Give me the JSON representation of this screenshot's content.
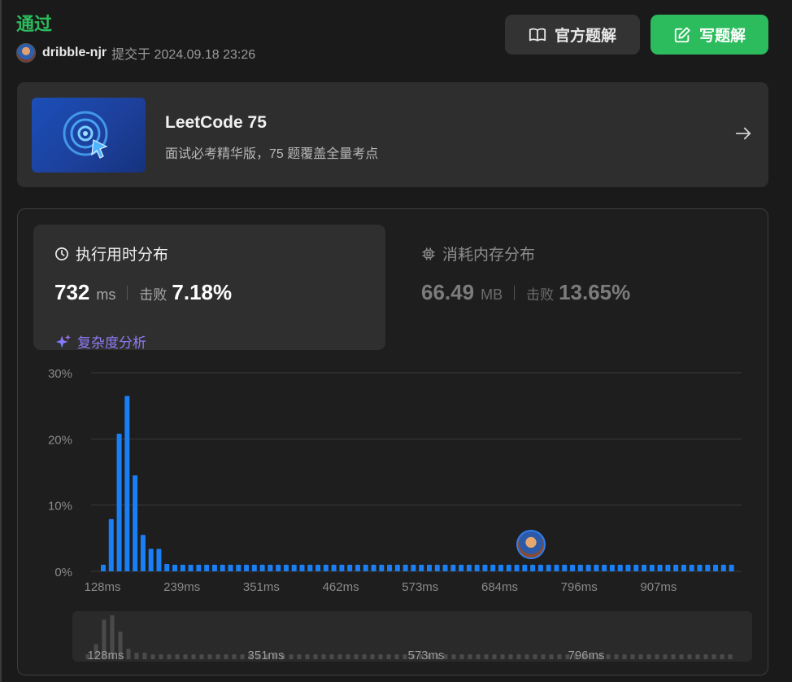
{
  "header": {
    "status": "通过",
    "username": "dribble-njr",
    "submitted_text": "提交于 2024.09.18 23:26",
    "official_solution_label": "官方题解",
    "write_solution_label": "写题解"
  },
  "promo": {
    "title": "LeetCode 75",
    "subtitle": "面试必考精华版，75 题覆盖全量考点"
  },
  "runtime": {
    "title": "执行用时分布",
    "value": "732",
    "unit": "ms",
    "beats_label": "击败",
    "beats_pct": "7.18%",
    "complexity_label": "复杂度分析"
  },
  "memory": {
    "title": "消耗内存分布",
    "value": "66.49",
    "unit": "MB",
    "beats_label": "击败",
    "beats_pct": "13.65%"
  },
  "colors": {
    "accent_green": "#2cbb5d",
    "bar_blue": "#1a7ff5",
    "complexity_purple": "#8e7cf5"
  },
  "chart_data": {
    "type": "bar",
    "ylim": [
      0,
      30
    ],
    "y_ticks": [
      "30%",
      "20%",
      "10%",
      "0%"
    ],
    "x_tick_labels": [
      "128ms",
      "239ms",
      "351ms",
      "462ms",
      "573ms",
      "684ms",
      "796ms",
      "907ms"
    ],
    "values": [
      1,
      7.9,
      20.8,
      26.5,
      14.5,
      5.5,
      3.4,
      3.4,
      1.1,
      1,
      1,
      1,
      1,
      1,
      1,
      1,
      1,
      1,
      1,
      1,
      1,
      1,
      1,
      1,
      1,
      1,
      1,
      1,
      1,
      1,
      1,
      1,
      1,
      1,
      1,
      1,
      1,
      1,
      1,
      1,
      1,
      1,
      1,
      1,
      1,
      1,
      1,
      1,
      1,
      1,
      1,
      1,
      1,
      1,
      1,
      1,
      1,
      1,
      1,
      1,
      1,
      1,
      1,
      1,
      1,
      1,
      1,
      1,
      1,
      1,
      1,
      1,
      1,
      1,
      1,
      1,
      1,
      1,
      1,
      1
    ],
    "current_value_label": "732ms",
    "brush_tick_labels": [
      "128ms",
      "351ms",
      "573ms",
      "796ms"
    ]
  }
}
